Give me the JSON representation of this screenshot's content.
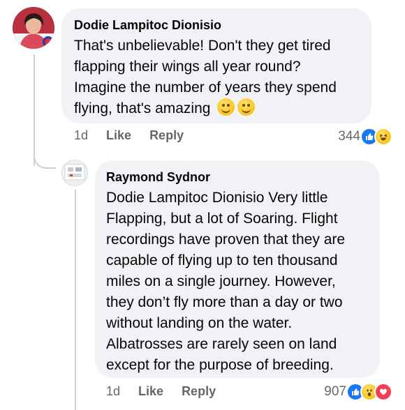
{
  "comments": [
    {
      "author": "Dodie Lampitoc Dionisio",
      "lines": [
        "That's unbelievable! Don't they get tired",
        "flapping their wings all year round?",
        "Imagine the number of years they spend",
        "flying, that's amazing"
      ],
      "emojis": [
        "smiling-face-icon",
        "grinning-face-icon"
      ],
      "time": "1d",
      "like_label": "Like",
      "reply_label": "Reply",
      "reaction_count": "344",
      "reactions": [
        "like",
        "haha"
      ]
    },
    {
      "author": "Raymond Sydnor",
      "lines": [
        "Dodie Lampitoc Dionisio  Very little",
        "Flapping, but a lot of Soaring. Flight",
        "recordings have proven that they are",
        "capable of flying up to ten thousand",
        "miles on a single journey. However,",
        "they don’t fly more than a day or two",
        "without landing on the water.",
        "Albatrosses are rarely seen on land",
        "except for the purpose of breeding."
      ],
      "time": "1d",
      "like_label": "Like",
      "reply_label": "Reply",
      "reaction_count": "907",
      "reactions": [
        "like",
        "wow",
        "love"
      ]
    }
  ],
  "colors": {
    "bubble": "#f0f2f5",
    "secondary_text": "#65676b",
    "like_blue": "#1877f2",
    "love_red": "#f33e58",
    "thread_line": "#ced0d4"
  }
}
